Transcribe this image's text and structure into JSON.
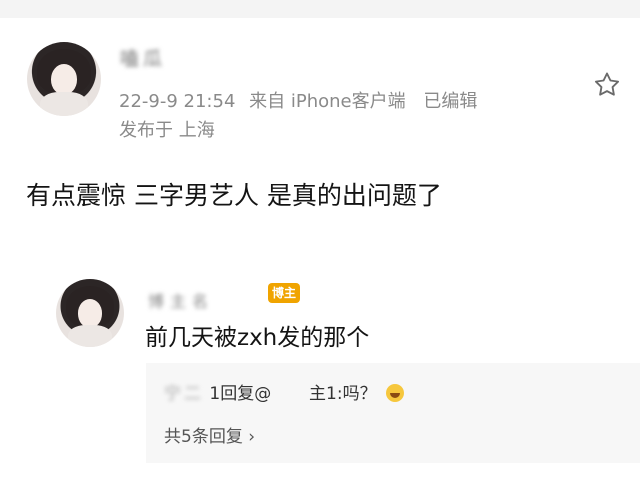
{
  "post": {
    "username": "嗑瓜",
    "time": "22-9-9 21:54",
    "source": "来自 iPhone客户端",
    "edited": "已编辑",
    "location": "发布于 上海",
    "content": "有点震惊 三字男艺人 是真的出问题了"
  },
  "reply": {
    "username": "博主名",
    "badge": "博主",
    "text": "前几天被zxh发的那个",
    "sub_reply_prefix": "宁二",
    "sub_reply_mid": "1回复@",
    "sub_reply_suffix": "主1:吗？",
    "more_replies": "共5条回复 ›"
  },
  "colors": {
    "badge": "#f0a400",
    "meta_text": "#8a8a8a",
    "sub_reply_bg": "#f7f7f7"
  },
  "icons": {
    "favorite": "star-outline",
    "emoji": "laughing-face"
  }
}
